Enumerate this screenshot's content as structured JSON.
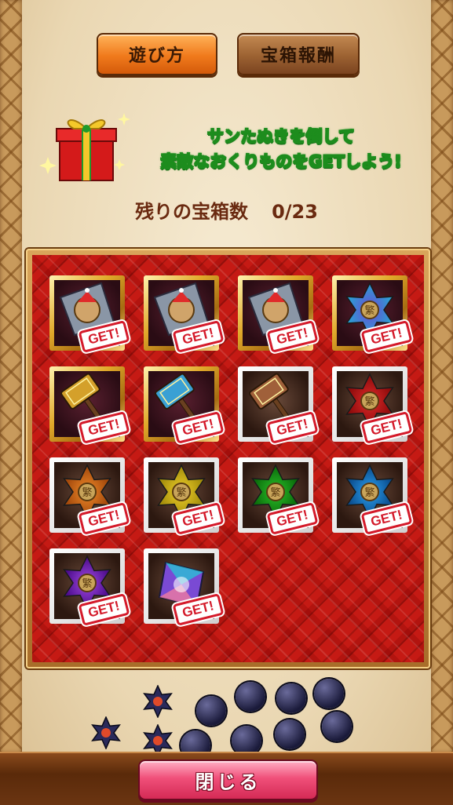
{
  "header": {
    "howto_label": "遊び方",
    "reward_label": "宝箱報酬"
  },
  "banner": {
    "line1": "サンたぬきを倒して",
    "line2": "素敵なおくりものをGETしよう!"
  },
  "remaining": {
    "label": "残りの宝箱数",
    "count": "0/23"
  },
  "items": [
    {
      "icon": "santa-shield-icon",
      "frame": "gold",
      "stamp": "GET!"
    },
    {
      "icon": "santa-shield-icon",
      "frame": "gold",
      "stamp": "GET!"
    },
    {
      "icon": "santa-shield-icon",
      "frame": "gold",
      "stamp": "GET!"
    },
    {
      "icon": "rainbow-star-icon",
      "frame": "gold",
      "stamp": "GET!"
    },
    {
      "icon": "gold-hammer-icon",
      "frame": "gold",
      "stamp": "GET!"
    },
    {
      "icon": "blue-hammer-icon",
      "frame": "gold",
      "stamp": "GET!"
    },
    {
      "icon": "bronze-hammer-icon",
      "frame": "silver",
      "stamp": "GET!"
    },
    {
      "icon": "red-star-icon",
      "frame": "silver",
      "stamp": "GET!"
    },
    {
      "icon": "orange-star-icon",
      "frame": "silver",
      "stamp": "GET!"
    },
    {
      "icon": "yellow-star-icon",
      "frame": "silver",
      "stamp": "GET!"
    },
    {
      "icon": "green-star-icon",
      "frame": "silver",
      "stamp": "GET!"
    },
    {
      "icon": "blue-star-icon",
      "frame": "silver",
      "stamp": "GET!"
    },
    {
      "icon": "purple-star-icon",
      "frame": "silver",
      "stamp": "GET!"
    },
    {
      "icon": "rainbow-crystal-icon",
      "frame": "silver",
      "stamp": "GET!"
    }
  ],
  "footer": {
    "close_label": "閉じる"
  },
  "colors": {
    "board_red": "#c51a14",
    "stamp_red": "#d41a2a",
    "close_pink": "#f0507a",
    "howto_orange": "#f07a1c",
    "reward_brown": "#9c6232"
  }
}
